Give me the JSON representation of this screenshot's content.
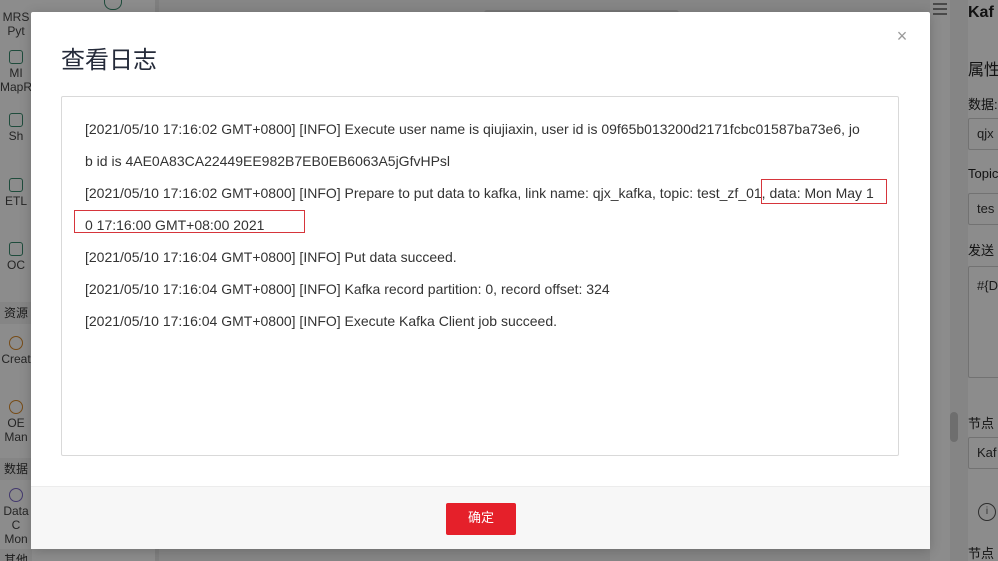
{
  "left_rail": {
    "top_items": [
      "MRS",
      "Pyt"
    ],
    "items": [
      {
        "lines": [
          "MI",
          "MapR"
        ]
      },
      {
        "lines": [
          "Sh"
        ]
      },
      {
        "lines": [
          "ETL"
        ]
      },
      {
        "lines": [
          "OC"
        ]
      }
    ],
    "section_resources": "资源",
    "resource_items": [
      {
        "lines": [
          "Creat"
        ]
      },
      {
        "lines": [
          "OE",
          "Man"
        ]
      }
    ],
    "section_data": "数据",
    "data_items": [
      {
        "lines": [
          "Data C",
          "Mon"
        ]
      }
    ],
    "section_other": "其他"
  },
  "right_panel": {
    "title": "Kaf",
    "attributes_label": "属性",
    "data_source_label": "数据:",
    "data_source_value": "qjx",
    "topic_label": "Topic",
    "topic_value": "tes",
    "send_label": "发送",
    "send_value": "#{D",
    "node_label": "节点",
    "node_value": "Kaf",
    "node_label2": "节点"
  },
  "modal": {
    "title": "查看日志",
    "close_symbol": "×",
    "log_lines": [
      "[2021/05/10 17:16:02 GMT+0800] [INFO] Execute user name is qiujiaxin, user id is 09f65b013200d2171fcbc01587ba73e6, jo",
      "b id is 4AE0A83CA22449EE982B7EB0EB6063A5jGfvHPsl",
      "[2021/05/10 17:16:02 GMT+0800] [INFO] Prepare to put data to kafka, link name: qjx_kafka, topic: test_zf_01, data: Mon May 1",
      "0 17:16:00 GMT+08:00 2021",
      "[2021/05/10 17:16:04 GMT+0800] [INFO] Put data succeed.",
      "[2021/05/10 17:16:04 GMT+0800] [INFO] Kafka record partition: 0, record offset: 324",
      "[2021/05/10 17:16:04 GMT+0800] [INFO] Execute Kafka Client job succeed."
    ],
    "ok_label": "确定"
  },
  "colors": {
    "primary_button": "#e5202a",
    "highlight_border": "#d6353b"
  }
}
